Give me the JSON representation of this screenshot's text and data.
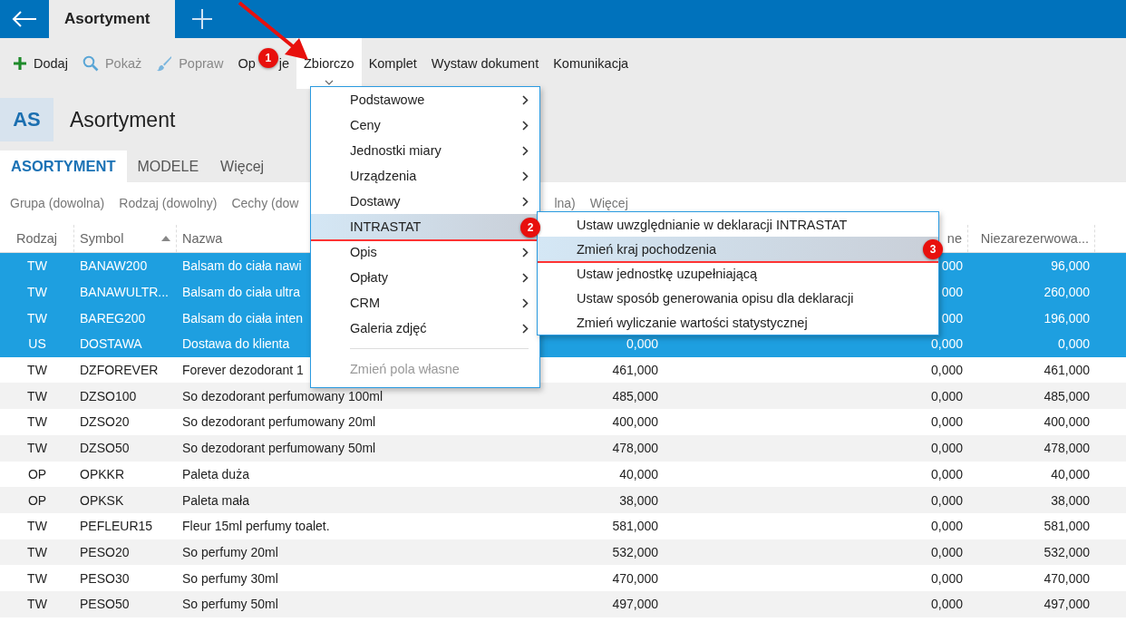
{
  "top_bar": {
    "tab": "Asortyment"
  },
  "toolbar": [
    {
      "label": "Dodaj",
      "kind": "plus",
      "disabled": false,
      "active": false
    },
    {
      "label": "Pokaż",
      "kind": "search",
      "disabled": true,
      "active": false
    },
    {
      "label": "Popraw",
      "kind": "brush",
      "disabled": true,
      "active": false
    },
    {
      "label_parts": [
        "Op",
        "je"
      ],
      "badge": "1",
      "disabled": false,
      "active": false
    },
    {
      "label": "Zbiorczo",
      "disabled": false,
      "active": true
    },
    {
      "label": "Komplet",
      "disabled": false,
      "active": false
    },
    {
      "label": "Wystaw dokument",
      "disabled": false,
      "active": false
    },
    {
      "label": "Komunikacja",
      "disabled": false,
      "active": false
    }
  ],
  "page": {
    "initials": "AS",
    "title": "Asortyment"
  },
  "tabs": [
    {
      "label": "ASORTYMENT",
      "selected": true
    },
    {
      "label": "MODELE",
      "selected": false
    },
    {
      "label": "Więcej",
      "selected": false
    }
  ],
  "filters": [
    "Grupa (dowolna)",
    "Rodzaj (dowolny)",
    "Cechy (dow",
    "lna)",
    "Więcej"
  ],
  "table": {
    "columns": [
      {
        "label": "Rodzaj"
      },
      {
        "label": "Symbol",
        "sorted": true
      },
      {
        "label": "Nazwa"
      },
      {},
      {
        "label": "ne"
      },
      {
        "label": "Niezarezerwowa..."
      }
    ],
    "rows": [
      {
        "selected": true,
        "cells": [
          "TW",
          "BANAW200",
          "Balsam do ciała nawi",
          "",
          "000",
          "96,000"
        ]
      },
      {
        "selected": true,
        "cells": [
          "TW",
          "BANAWULTR...",
          "Balsam do ciała ultra",
          "",
          "000",
          "260,000"
        ]
      },
      {
        "selected": true,
        "cells": [
          "TW",
          "BAREG200",
          "Balsam do ciała inten",
          "",
          "000",
          "196,000"
        ]
      },
      {
        "selected": true,
        "cells": [
          "US",
          "DOSTAWA",
          "Dostawa do klienta",
          "0,000",
          "0,000",
          "0,000"
        ]
      },
      {
        "selected": false,
        "cells": [
          "TW",
          "DZFOREVER",
          "Forever dezodorant 1",
          "461,000",
          "0,000",
          "461,000"
        ]
      },
      {
        "selected": false,
        "cells": [
          "TW",
          "DZSO100",
          "So dezodorant perfumowany 100ml",
          "485,000",
          "0,000",
          "485,000"
        ]
      },
      {
        "selected": false,
        "cells": [
          "TW",
          "DZSO20",
          "So dezodorant perfumowany 20ml",
          "400,000",
          "0,000",
          "400,000"
        ]
      },
      {
        "selected": false,
        "cells": [
          "TW",
          "DZSO50",
          "So dezodorant perfumowany 50ml",
          "478,000",
          "0,000",
          "478,000"
        ]
      },
      {
        "selected": false,
        "cells": [
          "OP",
          "OPKKR",
          "Paleta duża",
          "40,000",
          "0,000",
          "40,000"
        ]
      },
      {
        "selected": false,
        "cells": [
          "OP",
          "OPKSK",
          "Paleta mała",
          "38,000",
          "0,000",
          "38,000"
        ]
      },
      {
        "selected": false,
        "cells": [
          "TW",
          "PEFLEUR15",
          "Fleur 15ml perfumy toalet.",
          "581,000",
          "0,000",
          "581,000"
        ]
      },
      {
        "selected": false,
        "cells": [
          "TW",
          "PESO20",
          "So perfumy 20ml",
          "532,000",
          "0,000",
          "532,000"
        ]
      },
      {
        "selected": false,
        "cells": [
          "TW",
          "PESO30",
          "So perfumy 30ml",
          "470,000",
          "0,000",
          "470,000"
        ]
      },
      {
        "selected": false,
        "cells": [
          "TW",
          "PESO50",
          "So perfumy 50ml",
          "497,000",
          "0,000",
          "497,000"
        ]
      }
    ]
  },
  "menu": {
    "items": [
      {
        "kind": "item",
        "label": "Podstawowe",
        "submenu": true,
        "selected": false,
        "disabled": false
      },
      {
        "kind": "item",
        "label": "Ceny",
        "submenu": true,
        "selected": false,
        "disabled": false
      },
      {
        "kind": "item",
        "label": "Jednostki miary",
        "submenu": true,
        "selected": false,
        "disabled": false
      },
      {
        "kind": "item",
        "label": "Urządzenia",
        "submenu": true,
        "selected": false,
        "disabled": false
      },
      {
        "kind": "item",
        "label": "Dostawy",
        "submenu": true,
        "selected": false,
        "disabled": false
      },
      {
        "kind": "item",
        "label": "INTRASTAT",
        "submenu": false,
        "selected": true,
        "disabled": false,
        "badge": "2"
      },
      {
        "kind": "item",
        "label": "Opis",
        "submenu": true,
        "selected": false,
        "disabled": false
      },
      {
        "kind": "item",
        "label": "Opłaty",
        "submenu": true,
        "selected": false,
        "disabled": false
      },
      {
        "kind": "item",
        "label": "CRM",
        "submenu": true,
        "selected": false,
        "disabled": false
      },
      {
        "kind": "item",
        "label": "Galeria zdjęć",
        "submenu": true,
        "selected": false,
        "disabled": false
      },
      {
        "kind": "separator"
      },
      {
        "kind": "item",
        "label": "Zmień pola własne",
        "submenu": false,
        "selected": false,
        "disabled": true
      }
    ]
  },
  "submenu": {
    "items": [
      {
        "label": "Ustaw uwzględnianie w deklaracji INTRASTAT",
        "selected": false
      },
      {
        "label": "Zmień kraj pochodzenia",
        "selected": true,
        "badge": "3"
      },
      {
        "label": "Ustaw jednostkę uzupełniającą",
        "selected": false
      },
      {
        "label": "Ustaw sposób generowania opisu dla deklaracji",
        "selected": false
      },
      {
        "label": "Zmień wyliczanie wartości statystycznej",
        "selected": false
      }
    ]
  }
}
